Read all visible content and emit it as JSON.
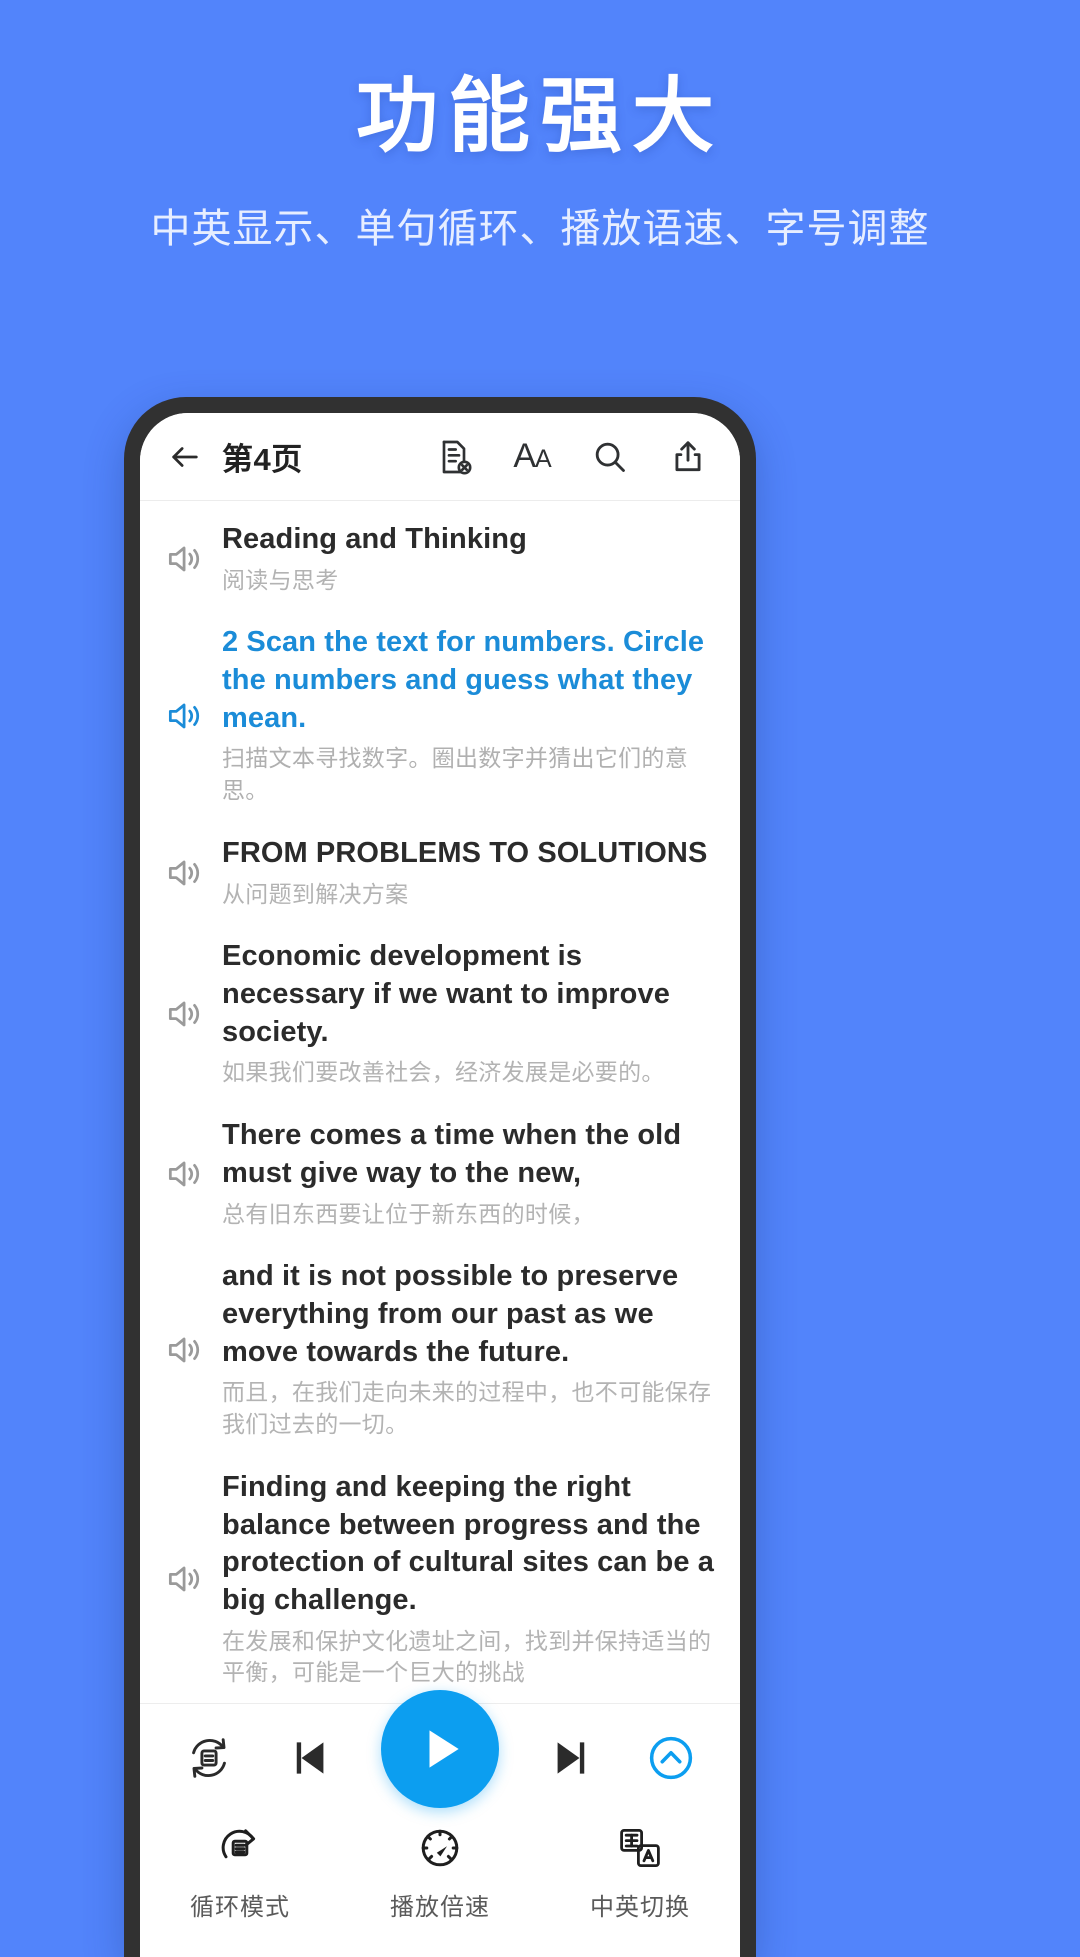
{
  "promo": {
    "title": "功能强大",
    "subtitle": "中英显示、单句循环、播放语速、字号调整",
    "bg_color": "#5284fb"
  },
  "appbar": {
    "back_icon": "arrow-left-icon",
    "page_title": "第4页",
    "tools": [
      {
        "name": "clear-note-icon",
        "label": "清除笔记"
      },
      {
        "name": "font-size-icon",
        "label": "AA"
      },
      {
        "name": "search-icon",
        "label": "搜索"
      },
      {
        "name": "share-icon",
        "label": "分享"
      }
    ]
  },
  "reader": {
    "accent_color": "#1b8cd8",
    "paragraphs": [
      {
        "en": "Reading and Thinking",
        "zh": "阅读与思考",
        "active": false,
        "speaker_icon": "speaker-icon"
      },
      {
        "en": "2 Scan the text for numbers. Circle the numbers and guess what they mean.",
        "zh": "扫描文本寻找数字。圈出数字并猜出它们的意思。",
        "active": true,
        "speaker_icon": "speaker-icon"
      },
      {
        "en": "FROM PROBLEMS TO SOLUTIONS",
        "zh": "从问题到解决方案",
        "active": false,
        "speaker_icon": "speaker-icon"
      },
      {
        "en": "Economic development is necessary if we want to improve society.",
        "zh": "如果我们要改善社会，经济发展是必要的。",
        "active": false,
        "speaker_icon": "speaker-icon"
      },
      {
        "en": "There comes a time when the old must give way to the new,",
        "zh": "总有旧东西要让位于新东西的时候，",
        "active": false,
        "speaker_icon": "speaker-icon"
      },
      {
        "en": "and it is not possible to preserve everything from our past as we move towards the future.",
        "zh": "而且，在我们走向未来的过程中，也不可能保存我们过去的一切。",
        "active": false,
        "speaker_icon": "speaker-icon"
      },
      {
        "en": "Finding and keeping the right balance between progress and the protection of cultural sites can be a big challenge.",
        "zh": "在发展和保护文化遗址之间，找到并保持适当的平衡，可能是一个巨大的挑战",
        "active": false,
        "speaker_icon": "speaker-icon"
      }
    ]
  },
  "player": {
    "play_color": "#0c9ef0",
    "controls": [
      {
        "name": "sentence-loop-button",
        "glyph": "句"
      },
      {
        "name": "previous-sentence-button"
      },
      {
        "name": "play-button"
      },
      {
        "name": "next-sentence-button"
      },
      {
        "name": "collapse-panel-button"
      }
    ]
  },
  "tabbar": {
    "items": [
      {
        "icon": "loop-mode-icon",
        "glyph": "篇",
        "label": "循环模式"
      },
      {
        "icon": "playback-speed-icon",
        "label": "播放倍速"
      },
      {
        "icon": "language-toggle-icon",
        "label": "中英切换"
      }
    ]
  }
}
